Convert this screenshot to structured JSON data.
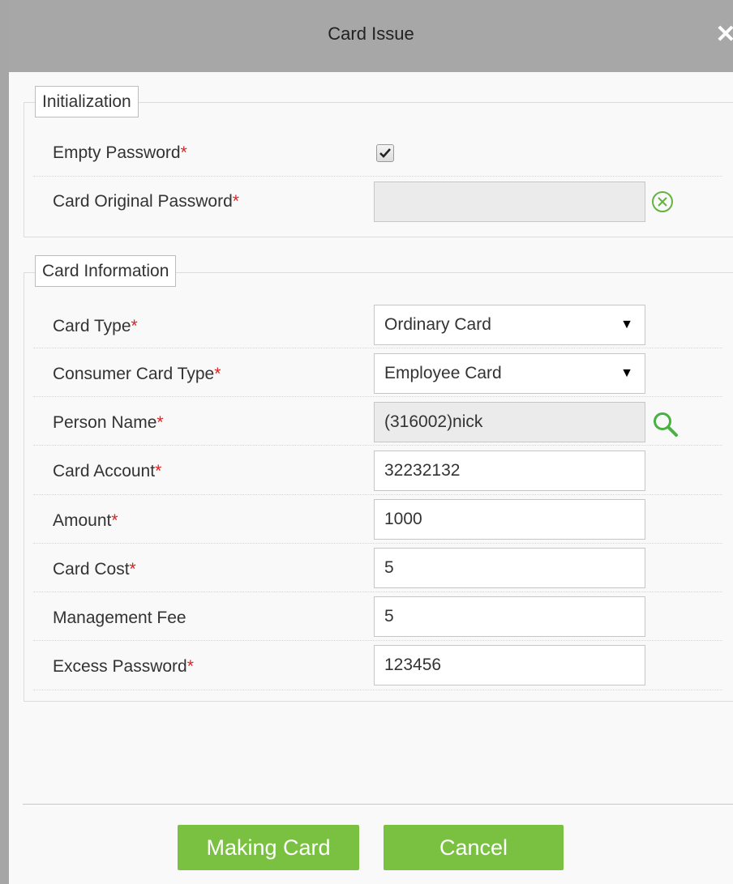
{
  "dialog": {
    "title": "Card Issue",
    "close_icon": "close-icon",
    "accent_color": "#7ac142"
  },
  "initialization": {
    "legend": "Initialization",
    "empty_password": {
      "label": "Empty Password",
      "required_mark": "*",
      "checked": true
    },
    "card_original_password": {
      "label": "Card Original Password",
      "required_mark": "*",
      "value": "",
      "clear_icon": "clear-circle-icon"
    }
  },
  "card_information": {
    "legend": "Card Information",
    "card_type": {
      "label": "Card Type",
      "required_mark": "*",
      "value": "Ordinary Card",
      "arrow": "▼"
    },
    "consumer_card_type": {
      "label": "Consumer Card Type",
      "required_mark": "*",
      "value": "Employee Card",
      "arrow": "▼"
    },
    "person_name": {
      "label": "Person Name",
      "required_mark": "*",
      "value": "(316002)nick",
      "search_icon": "search-icon"
    },
    "card_account": {
      "label": "Card Account",
      "required_mark": "*",
      "value": "32232132"
    },
    "amount": {
      "label": "Amount",
      "required_mark": "*",
      "value": "1000"
    },
    "card_cost": {
      "label": "Card Cost",
      "required_mark": "*",
      "value": "5"
    },
    "management_fee": {
      "label": "Management Fee",
      "value": "5"
    },
    "excess_password": {
      "label": "Excess Password",
      "required_mark": "*",
      "value": "123456"
    }
  },
  "footer": {
    "making_card_label": "Making Card",
    "cancel_label": "Cancel"
  }
}
